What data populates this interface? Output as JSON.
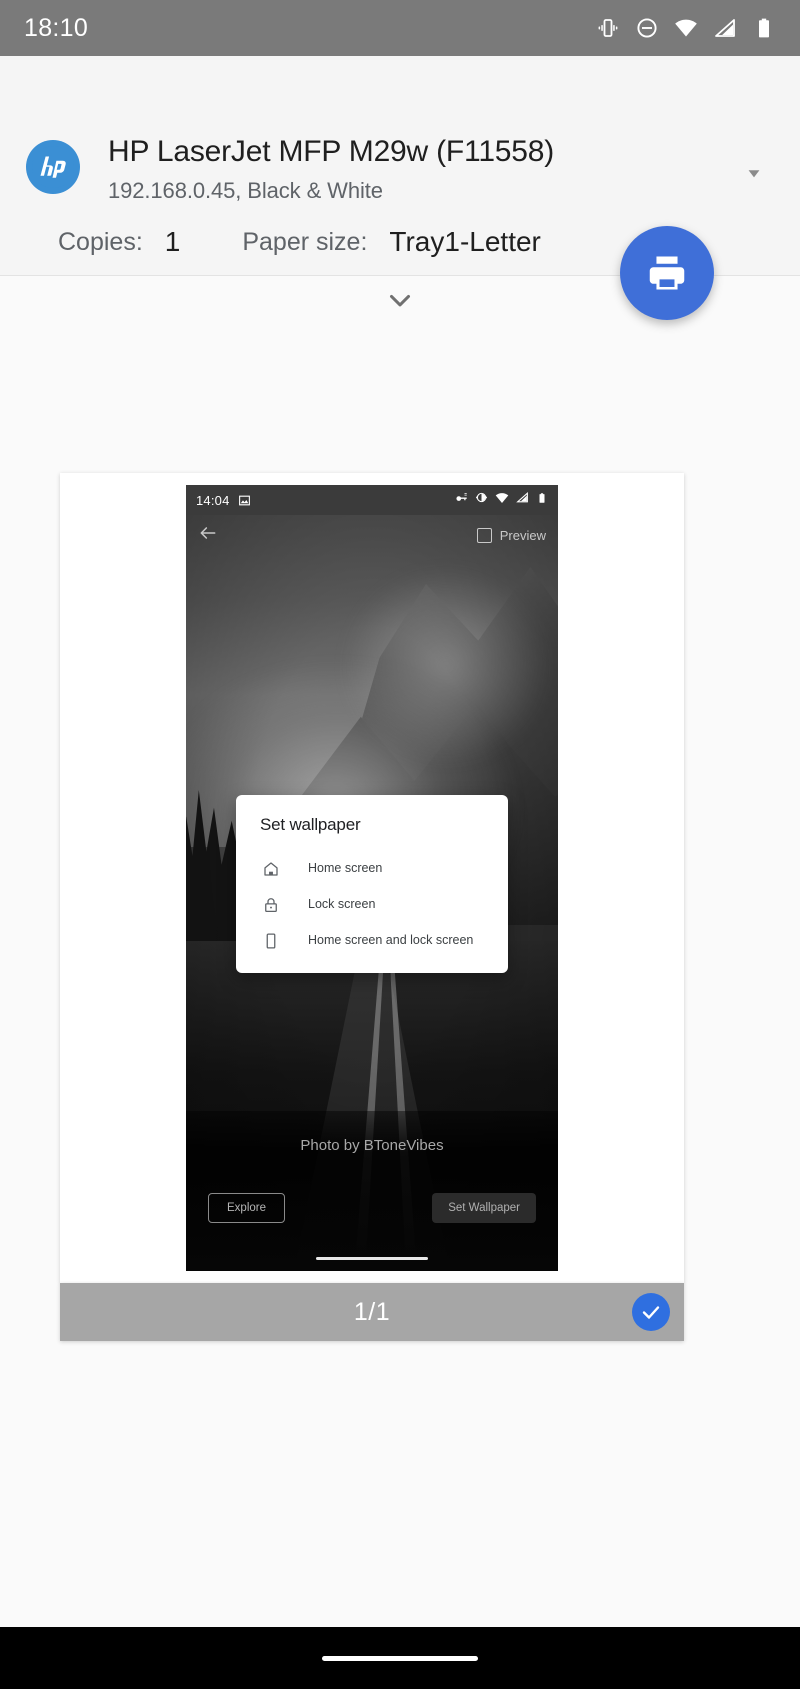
{
  "system_status_bar": {
    "time": "18:10",
    "icons": [
      "vibrate-icon",
      "do-not-disturb-icon",
      "wifi-icon",
      "cellular-signal-icon",
      "battery-icon"
    ]
  },
  "print_header": {
    "logo": "hp-logo",
    "printer_name": "HP LaserJet MFP M29w (F11558)",
    "printer_subtitle": "192.168.0.45, Black & White",
    "dropdown_icon": "chevron-down-icon",
    "copies_label": "Copies:",
    "copies_value": "1",
    "paper_size_label": "Paper size:",
    "paper_size_value": "Tray1-Letter",
    "expand_icon": "chevron-down-icon",
    "print_button_icon": "print-icon",
    "accent_color": "#3f6fd8",
    "hp_blue": "#3b8fd4"
  },
  "preview": {
    "page_indicator": "1/1",
    "selected_icon": "check-icon",
    "selected_color": "#2f6fe0",
    "phone": {
      "status_bar": {
        "time": "14:04",
        "left_icons": [
          "image-icon"
        ],
        "right_icons": [
          "vpn-key-icon",
          "vibrate-icon",
          "wifi-icon",
          "cellular-signal-icon",
          "battery-icon"
        ]
      },
      "app_bar": {
        "back_icon": "arrow-back-icon",
        "preview_checkbox_icon": "checkbox-unchecked-icon",
        "preview_label": "Preview"
      },
      "dialog": {
        "title": "Set wallpaper",
        "options": [
          {
            "icon": "home-icon",
            "label": "Home screen"
          },
          {
            "icon": "lock-icon",
            "label": "Lock screen"
          },
          {
            "icon": "phone-icon",
            "label": "Home screen and lock screen"
          }
        ]
      },
      "credit": "Photo by BToneVibes",
      "explore_button": "Explore",
      "set_wallpaper_button": "Set Wallpaper"
    }
  },
  "navigation_bar": {
    "gesture_pill": "home-gesture-pill"
  }
}
